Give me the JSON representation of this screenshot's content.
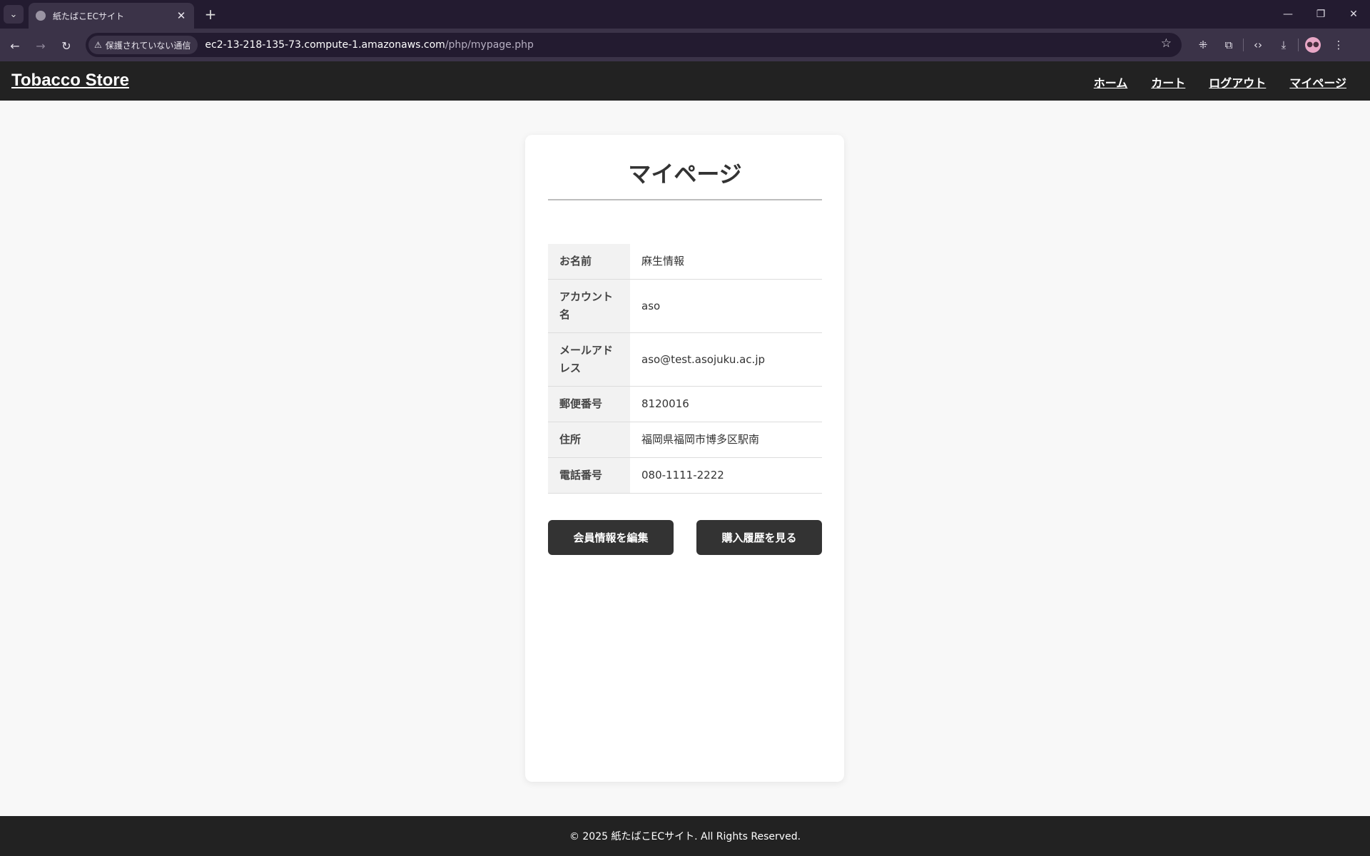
{
  "browser": {
    "tab_title": "紙たばこECサイト",
    "security_label": "保護されていない通信",
    "url_host": "ec2-13-218-135-73.compute-1.amazonaws.com",
    "url_path": "/php/mypage.php"
  },
  "site": {
    "logo": "Tobacco Store",
    "nav": [
      "ホーム",
      "カート",
      "ログアウト",
      "マイページ"
    ]
  },
  "page": {
    "title": "マイページ",
    "rows": [
      {
        "label": "お名前",
        "value": "麻生情報"
      },
      {
        "label": "アカウント名",
        "value": "aso"
      },
      {
        "label": "メールアドレス",
        "value": "aso@test.asojuku.ac.jp"
      },
      {
        "label": "郵便番号",
        "value": "8120016"
      },
      {
        "label": "住所",
        "value": "福岡県福岡市博多区駅南"
      },
      {
        "label": "電話番号",
        "value": "080-1111-2222"
      }
    ],
    "edit_button": "会員情報を編集",
    "history_button": "購入履歴を見る"
  },
  "footer": {
    "text": "© 2025 紙たばこECサイト. All Rights Reserved."
  }
}
